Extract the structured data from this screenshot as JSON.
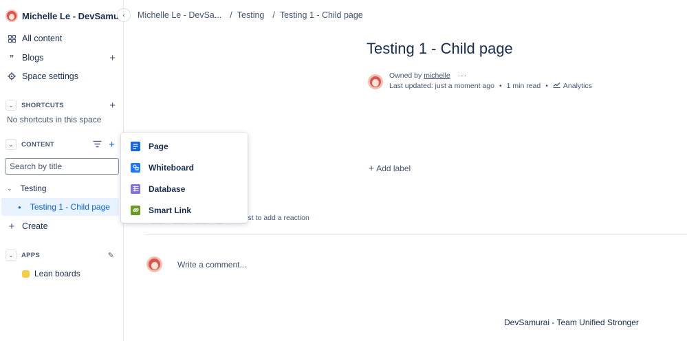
{
  "sidebar": {
    "space_name": "Michelle Le - DevSamurai",
    "nav": [
      {
        "label": "All content",
        "icon": "grid-icon"
      },
      {
        "label": "Blogs",
        "icon": "quote-icon"
      },
      {
        "label": "Space settings",
        "icon": "gear-icon"
      }
    ],
    "shortcuts": {
      "label": "SHORTCUTS",
      "empty_text": "No shortcuts in this space"
    },
    "content": {
      "label": "CONTENT",
      "search_placeholder": "Search by title"
    },
    "tree": [
      {
        "label": "Testing"
      },
      {
        "label": "Testing 1 - Child page",
        "selected": true
      }
    ],
    "create_label": "Create",
    "apps": {
      "label": "APPS",
      "items": [
        {
          "label": "Lean boards",
          "icon": "lean-boards-icon"
        }
      ]
    }
  },
  "breadcrumb": [
    "Michelle Le - DevSa...",
    "Testing",
    "Testing 1 - Child page"
  ],
  "page": {
    "title": "Testing 1 - Child page",
    "owned_by_prefix": "Owned by",
    "owner": "michelle",
    "last_updated": "Last updated: just a moment ago",
    "read_time": "1 min read",
    "analytics_label": "Analytics",
    "add_label": "Add label",
    "reaction_text": "e first to add a reaction",
    "comment_placeholder": "Write a comment...",
    "footer": "DevSamurai - Team Unified Stronger"
  },
  "create_menu": [
    {
      "label": "Page",
      "icon": "page-icon",
      "color": "#1868db"
    },
    {
      "label": "Whiteboard",
      "icon": "whiteboard-icon",
      "color": "#1d7afc"
    },
    {
      "label": "Database",
      "icon": "database-icon",
      "color": "#8270db"
    },
    {
      "label": "Smart Link",
      "icon": "smart-link-icon",
      "color": "#6a9a23"
    }
  ]
}
